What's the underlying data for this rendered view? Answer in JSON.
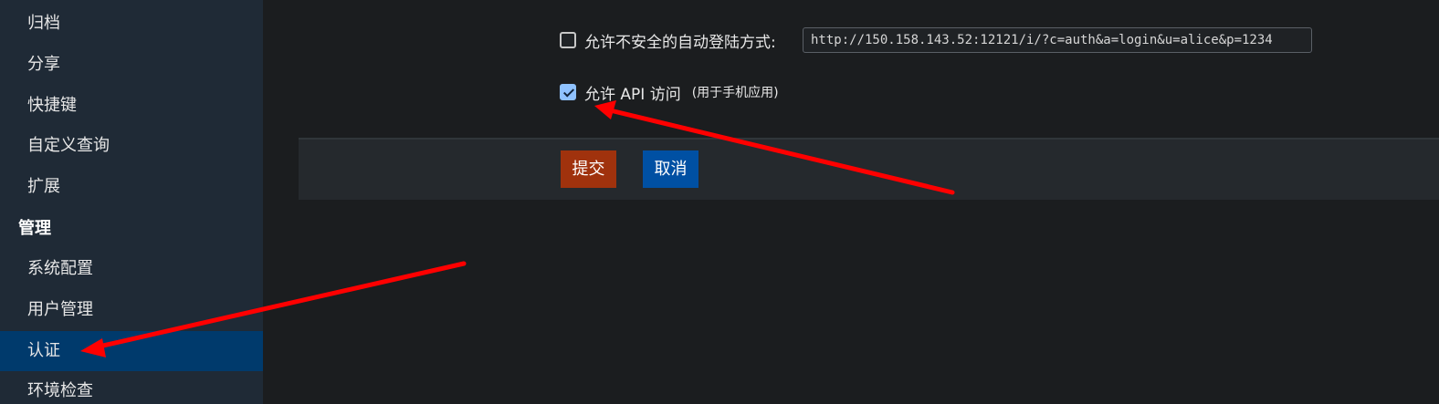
{
  "sidebar": {
    "items": [
      {
        "label": "归档"
      },
      {
        "label": "分享"
      },
      {
        "label": "快捷键"
      },
      {
        "label": "自定义查询"
      },
      {
        "label": "扩展"
      }
    ],
    "group": {
      "label": "管理"
    },
    "admin_items": [
      {
        "label": "系统配置"
      },
      {
        "label": "用户管理"
      },
      {
        "label": "认证",
        "active": true
      },
      {
        "label": "环境检查"
      }
    ]
  },
  "settings": {
    "unsafe_autologin": {
      "label": "允许不安全的自动登陆方式:",
      "checked": false,
      "url_value": "http://150.158.143.52:12121/i/?c=auth&a=login&u=alice&p=1234"
    },
    "api_access": {
      "label": "允许 API 访问",
      "hint": "(用于手机应用)",
      "checked": true
    }
  },
  "actions": {
    "submit_label": "提交",
    "cancel_label": "取消"
  },
  "colors": {
    "sidebar_bg": "#1f2a36",
    "sidebar_active": "#003a6c",
    "submit": "#a0320d",
    "cancel": "#0050a3",
    "annotation_arrow": "#ff0000"
  }
}
